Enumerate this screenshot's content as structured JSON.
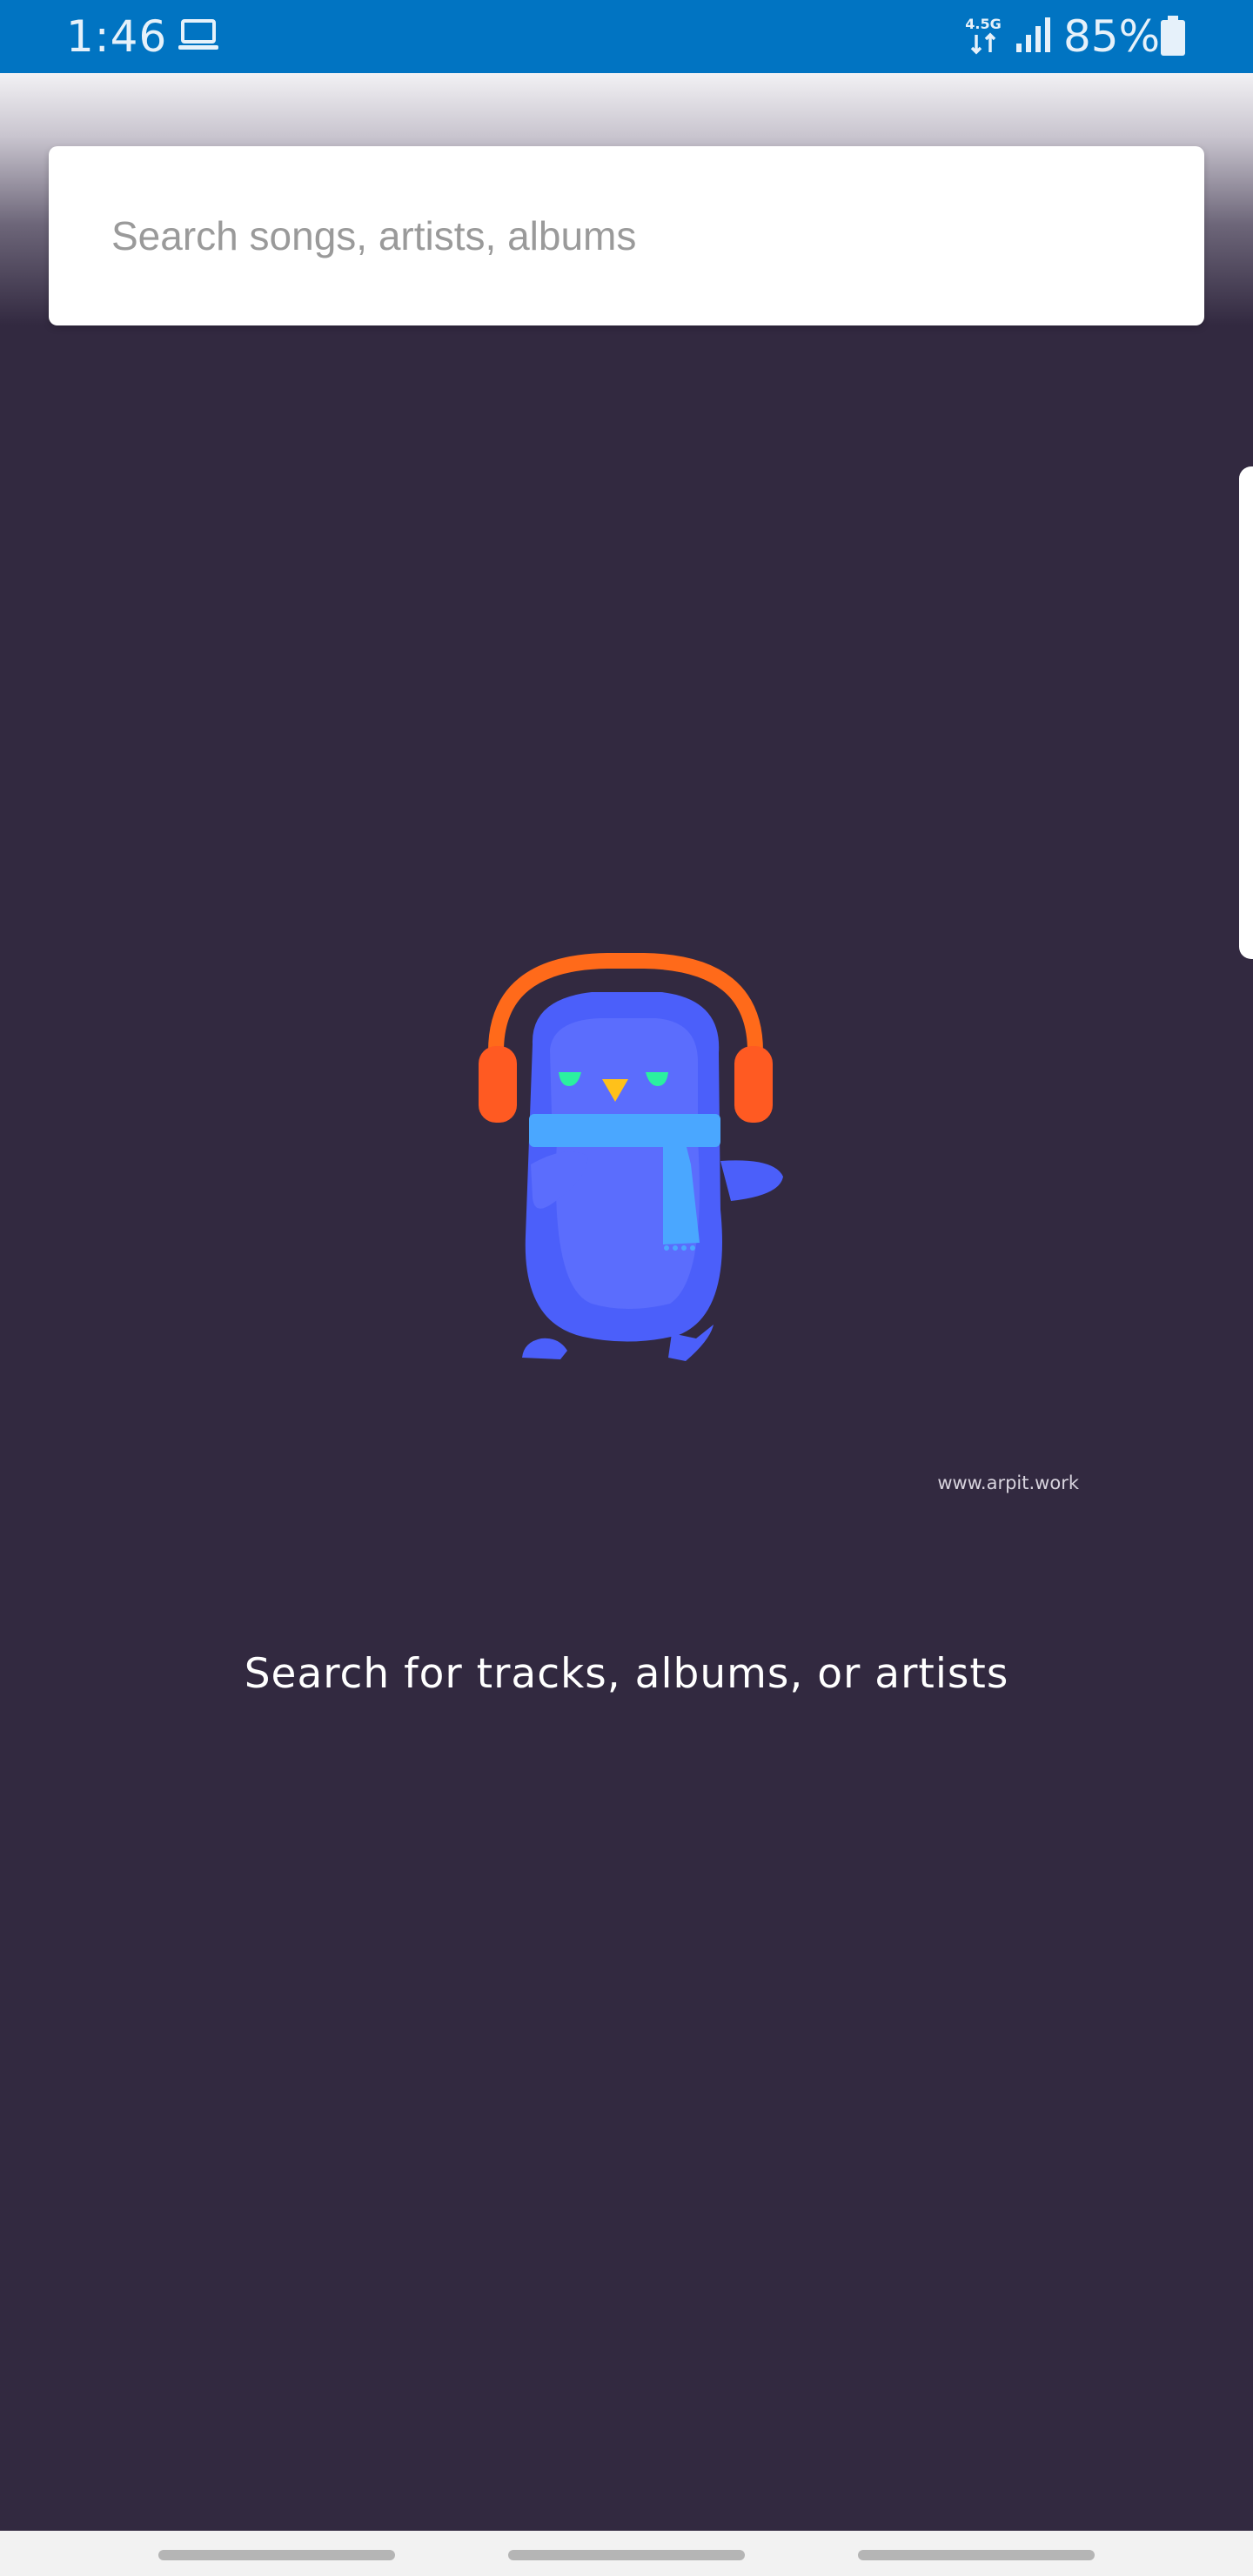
{
  "status_bar": {
    "time": "1:46",
    "network_label": "4.5G",
    "battery_percent": "85%",
    "icons": [
      "laptop-icon",
      "network-4-5g-icon",
      "signal-icon",
      "battery-icon"
    ]
  },
  "search": {
    "placeholder": "Search songs, artists, albums",
    "value": ""
  },
  "illustration": {
    "name": "penguin-with-headphones",
    "colors": {
      "background": "#322940",
      "body": "#4b5ffa",
      "belly": "#5b6dfd",
      "headphones": "#ff6a1a",
      "scarf": "#4aa7ff",
      "eyes": "#2bf0a0",
      "beak": "#ffc11a"
    }
  },
  "credit": "www.arpit.work",
  "empty_state": {
    "message": "Search for tracks, albums, or artists"
  },
  "colors": {
    "status_bar": "#0174c2",
    "background": "#322940",
    "nav_bar": "#f2f2f2"
  }
}
